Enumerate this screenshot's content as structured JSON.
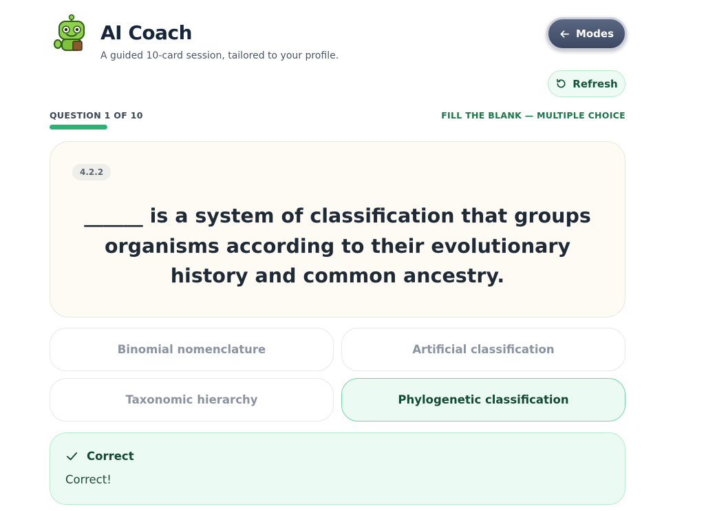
{
  "header": {
    "title": "AI Coach",
    "subtitle": "A guided 10-card session, tailored to your profile.",
    "modes_label": "Modes",
    "refresh_label": "Refresh",
    "mascot_icon": "robot-mascot-icon"
  },
  "progress": {
    "counter_label": "QUESTION 1 OF 10",
    "current": 1,
    "total": 10,
    "fraction": 0.1,
    "type_label": "FILL THE BLANK — MULTIPLE CHOICE"
  },
  "question": {
    "section": "4.2.2",
    "text": "______ is a system of classification that groups organisms according to their evolutionary history and common ancestry."
  },
  "options": [
    {
      "label": "Binomial nomenclature",
      "state": "dimmed"
    },
    {
      "label": "Artificial classification",
      "state": "dimmed"
    },
    {
      "label": "Taxonomic hierarchy",
      "state": "dimmed"
    },
    {
      "label": "Phylogenetic classification",
      "state": "correct"
    }
  ],
  "feedback": {
    "title": "Correct",
    "message": "Correct!"
  },
  "colors": {
    "accent_green": "#22b873",
    "correct_bg": "#ebfbf3",
    "correct_border": "#6fd9a5",
    "card_bg": "#fdfbf4",
    "modes_bg": "#4a5570"
  }
}
